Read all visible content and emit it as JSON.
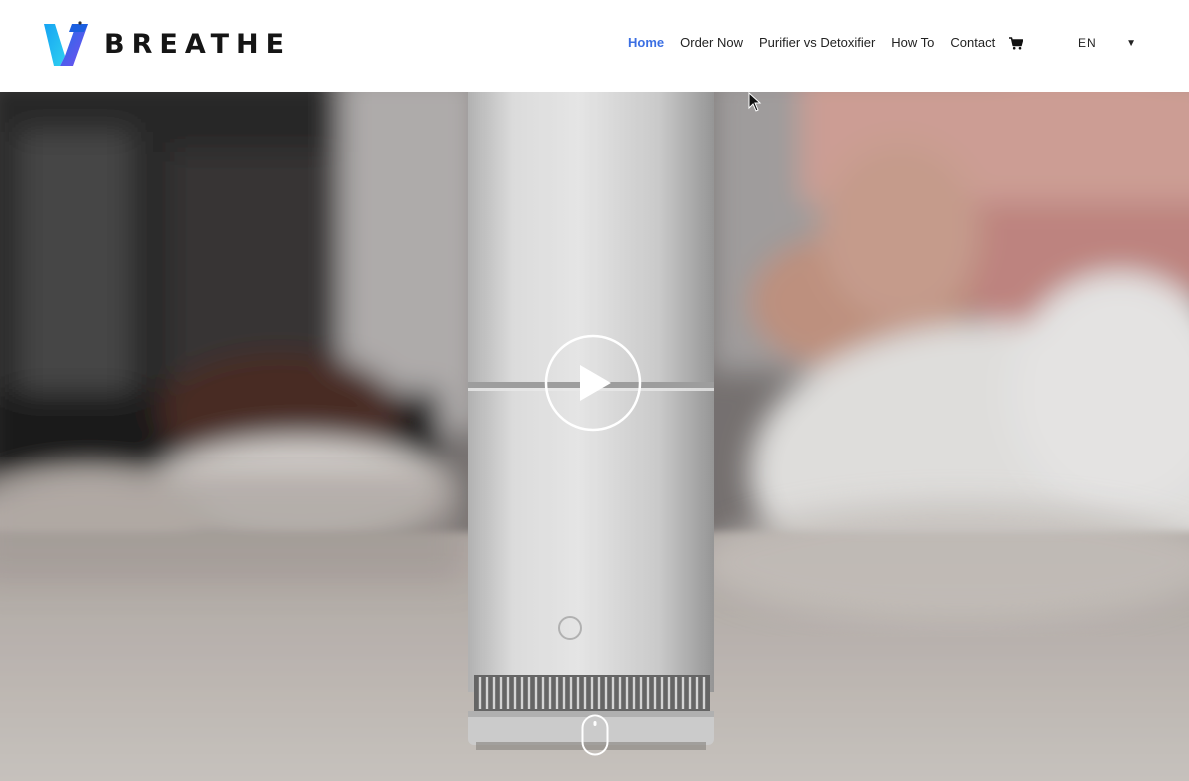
{
  "brand": {
    "name": "BREATHE",
    "logo_icon": "v-logo-icon",
    "accent": "#3b6fe3",
    "logo_gradient": [
      "#1aa0f2",
      "#7a5cf0"
    ]
  },
  "nav": {
    "items": [
      {
        "label": "Home",
        "active": true
      },
      {
        "label": "Order Now",
        "active": false
      },
      {
        "label": "Purifier vs Detoxifier",
        "active": false
      },
      {
        "label": "How To",
        "active": false
      },
      {
        "label": "Contact",
        "active": false
      }
    ],
    "cart_icon": "cart-icon",
    "language": {
      "selected": "EN",
      "caret_icon": "caret-down-icon"
    }
  },
  "hero": {
    "play_icon": "play-icon",
    "scroll_icon": "mouse-scroll-icon"
  }
}
